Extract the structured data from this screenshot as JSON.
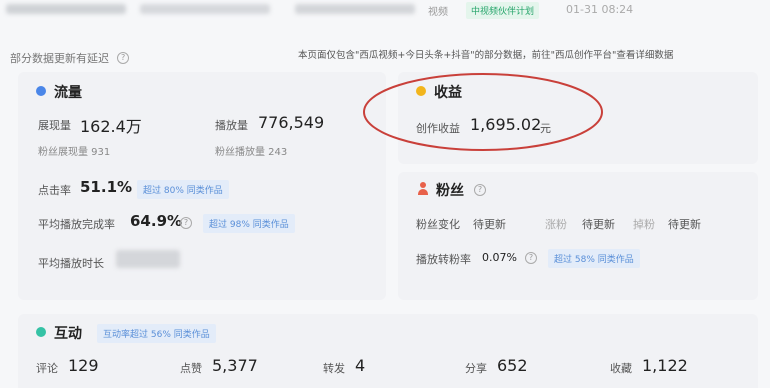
{
  "topbar": {
    "label_video": "视频",
    "tag": "中视频伙伴计划",
    "time": "01-31 08:24"
  },
  "notice": {
    "left": "部分数据更新有延迟",
    "right": "本页面仅包含\"西瓜视频+今日头条+抖音\"的部分数据，前往\"西瓜创作平台\"查看详细数据"
  },
  "traffic": {
    "title": "流量",
    "impressions_label": "展现量",
    "impressions_value": "162.4万",
    "plays_label": "播放量",
    "plays_value": "776,549",
    "fan_impressions": "粉丝展现量 931",
    "fan_plays": "粉丝播放量 243",
    "ctr_label": "点击率",
    "ctr_value": "51.1%",
    "ctr_chip": "超过 80% 同类作品",
    "completion_label": "平均播放完成率",
    "completion_value": "64.9%",
    "completion_chip": "超过 98% 同类作品",
    "avg_duration_label": "平均播放时长"
  },
  "income": {
    "title": "收益",
    "label": "创作收益",
    "value": "1,695.02",
    "unit": "元"
  },
  "fans": {
    "title": "粉丝",
    "change_label": "粉丝变化",
    "pending1": "待更新",
    "gain": "涨粉",
    "pending2": "待更新",
    "loss": "掉粉",
    "pending3": "待更新",
    "conversion_label": "播放转粉率",
    "conversion_value": "0.07%",
    "conversion_chip": "超过 58% 同类作品"
  },
  "interaction": {
    "title": "互动",
    "chip": "互动率超过 56% 同类作品",
    "comments_label": "评论",
    "comments_value": "129",
    "likes_label": "点赞",
    "likes_value": "5,377",
    "shares_label": "转发",
    "shares_value": "4",
    "share_label": "分享",
    "share_value": "652",
    "favorites_label": "收藏",
    "favorites_value": "1,122"
  },
  "colors": {
    "traffic_icon": "#4a86e8",
    "income_icon": "#f2b51c",
    "fans_icon": "#e8614a",
    "interaction_icon": "#35c2a5",
    "annotation_circle": "#c9403a",
    "chip_text": "#5a8fd8",
    "chip_bg": "#e3ecf9",
    "tag_text": "#27a56b"
  }
}
